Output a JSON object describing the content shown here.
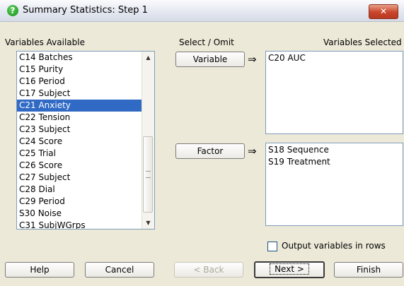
{
  "window": {
    "title": "Summary Statistics: Step 1",
    "close_glyph": "✕",
    "icon": "help-question-icon"
  },
  "left_panel": {
    "label": "Variables Available",
    "items": [
      "C14 Batches",
      "C15 Purity",
      "C16 Period",
      "C17 Subject",
      "C21 Anxiety",
      "C22 Tension",
      "C23 Subject",
      "C24 Score",
      "C25 Trial",
      "C26 Score",
      "C27 Subject",
      "C28 Dial",
      "C29 Period",
      "S30 Noise",
      "C31 SubjWGrps"
    ],
    "selected_index": 4
  },
  "middle": {
    "label": "Select / Omit",
    "variable_button": "Variable",
    "factor_button": "Factor",
    "arrow_glyph": "⇒"
  },
  "right_panel": {
    "label": "Variables Selected",
    "variable_items": [
      "C20 AUC"
    ],
    "factor_items": [
      "S18 Sequence",
      "S19 Treatment"
    ]
  },
  "options": {
    "output_rows_label": "Output variables in rows",
    "output_rows_checked": false
  },
  "buttons": {
    "help": "Help",
    "cancel": "Cancel",
    "back": "< Back",
    "next": "Next >",
    "finish": "Finish"
  },
  "colors": {
    "selection": "#316ac5",
    "dialog_bg": "#ece9d8",
    "close_button": "#c8452a"
  }
}
